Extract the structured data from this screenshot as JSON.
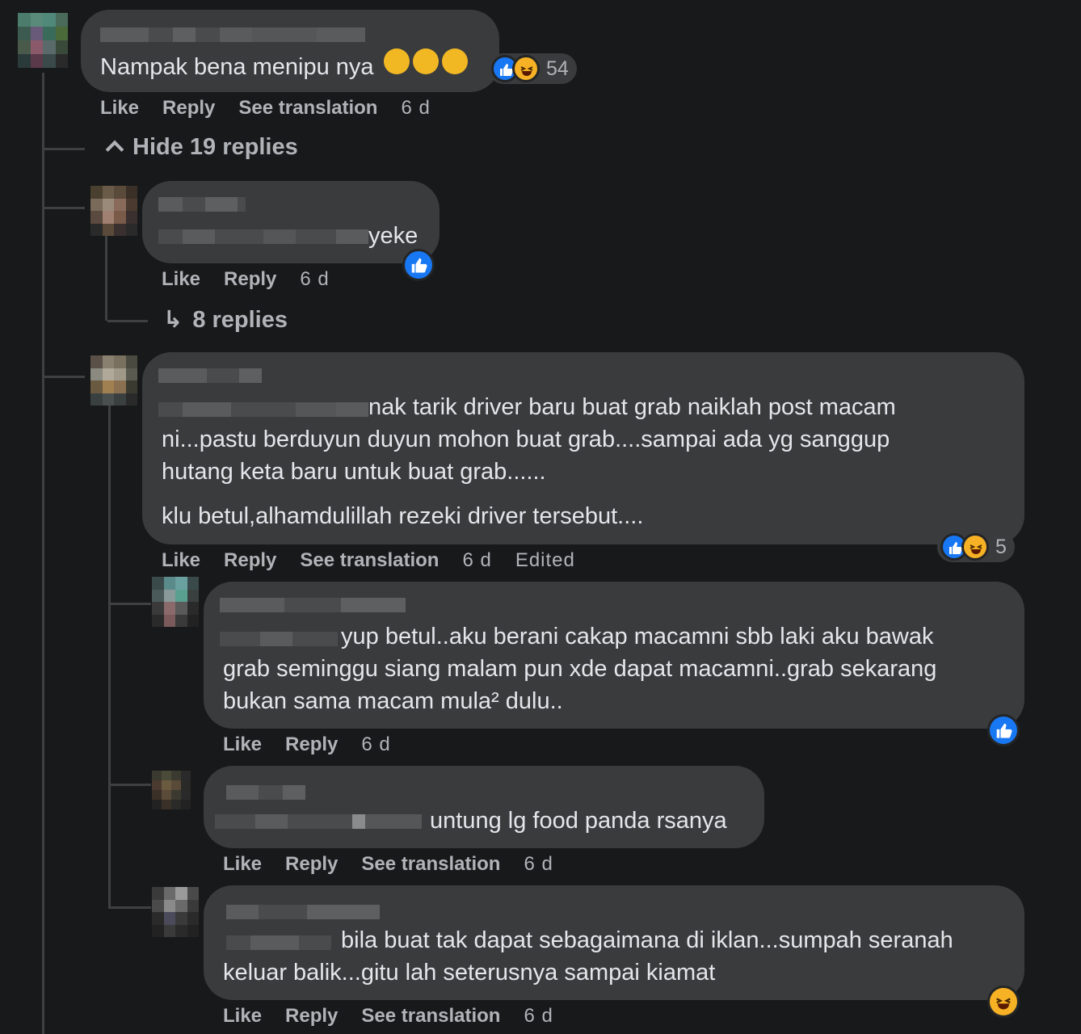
{
  "comments": [
    {
      "text": "Nampak bena menipu nya",
      "emoji_suffix": "sleeping-face x3",
      "reactions": {
        "types": [
          "like",
          "haha"
        ],
        "count": "54"
      },
      "actions": {
        "like": "Like",
        "reply": "Reply",
        "translate": "See translation",
        "time": "6 d"
      }
    }
  ],
  "hide_replies": "Hide 19 replies",
  "replies": [
    {
      "text": "yeke",
      "reactions": {
        "types": [
          "like"
        ]
      },
      "actions": {
        "like": "Like",
        "reply": "Reply",
        "time": "6 d"
      }
    },
    {
      "lines": [
        "nak tarik driver baru buat grab naiklah post macam",
        "ni...pastu berduyun duyun mohon buat grab....sampai ada yg sanggup",
        "hutang keta baru untuk buat grab......",
        "klu betul,alhamdulillah rezeki driver tersebut...."
      ],
      "reactions": {
        "types": [
          "like",
          "haha"
        ],
        "count": "5"
      },
      "actions": {
        "like": "Like",
        "reply": "Reply",
        "translate": "See translation",
        "time": "6 d",
        "edited": "Edited"
      }
    },
    {
      "lines": [
        "yup betul..aku berani cakap macamni sbb laki aku bawak",
        "grab seminggu siang malam pun xde dapat macamni..grab sekarang",
        "bukan sama macam mula² dulu.."
      ],
      "reactions": {
        "types": [
          "like"
        ]
      },
      "actions": {
        "like": "Like",
        "reply": "Reply",
        "time": "6 d"
      }
    },
    {
      "text": "untung lg food panda rsanya",
      "actions": {
        "like": "Like",
        "reply": "Reply",
        "translate": "See translation",
        "time": "6 d"
      }
    },
    {
      "lines": [
        "bila buat tak dapat sebagaimana di iklan...sumpah seranah",
        "keluar balik...gitu lah seterusnya sampai kiamat"
      ],
      "reactions": {
        "types": [
          "haha"
        ]
      },
      "actions": {
        "like": "Like",
        "reply": "Reply",
        "translate": "See translation",
        "time": "6 d"
      }
    }
  ],
  "view_replies": "8 replies",
  "colors": {
    "background": "#18191a",
    "bubble": "#3a3b3c",
    "text": "#e4e6eb",
    "muted": "#b0b3b8",
    "like_blue": "#1877f2",
    "haha_yellow": "#f7b125"
  }
}
